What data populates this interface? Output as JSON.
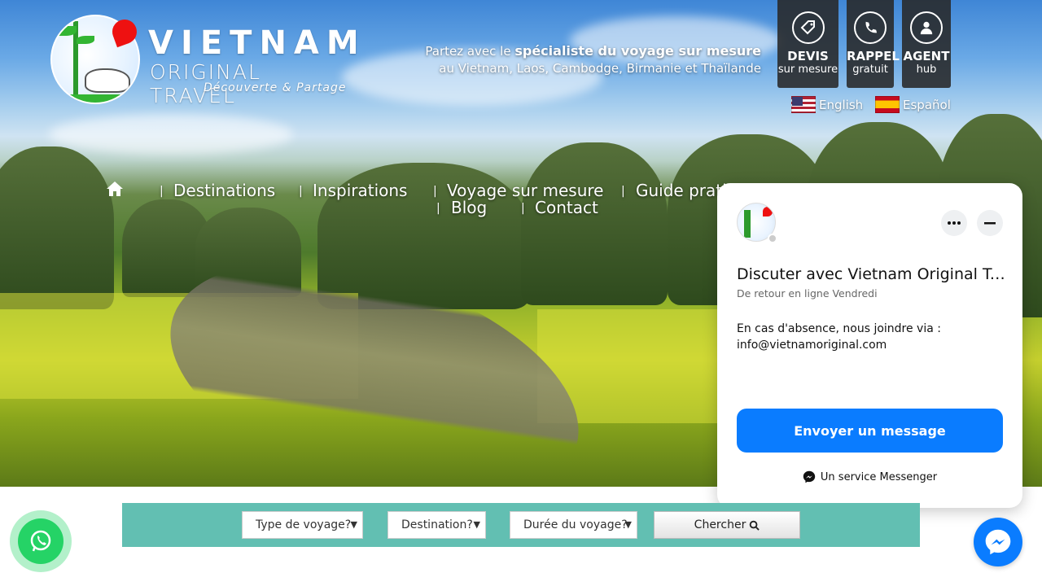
{
  "logo": {
    "word1": "VIETNAM",
    "word2": "ORIGINAL TRAVEL",
    "word3": "Découverte & Partage"
  },
  "tagline": {
    "line1_prefix": "Partez avec le ",
    "line1_bold": "spécialiste du voyage sur mesure",
    "line2": "au Vietnam, Laos, Cambodge, Birmanie et Thaïlande"
  },
  "top_buttons": [
    {
      "title": "DEVIS",
      "sub": "sur mesure",
      "icon": "tag-icon"
    },
    {
      "title": "RAPPEL",
      "sub": "gratuit",
      "icon": "phone-icon"
    },
    {
      "title": "AGENT",
      "sub": "hub",
      "icon": "user-icon"
    }
  ],
  "languages": [
    {
      "label": "English",
      "flag": "us-flag"
    },
    {
      "label": "Español",
      "flag": "es-flag"
    }
  ],
  "nav": {
    "home_icon": "home-icon",
    "items": [
      "Destinations",
      "Inspirations",
      "Voyage sur mesure",
      "Guide pratique",
      "Blog",
      "Contact"
    ]
  },
  "chat": {
    "title": "Discuter avec Vietnam Original Travel",
    "status": "De retour en ligne Vendredi",
    "message": "En cas d'absence, nous joindre via : info@vietnamoriginal.com",
    "send_label": "Envoyer un message",
    "footer": "Un service Messenger"
  },
  "search": {
    "type_label": "Type de voyage?",
    "destination_label": "Destination?",
    "duration_label": "Durée du voyage?",
    "button_label": "Chercher"
  },
  "colors": {
    "search_bg": "#62bfb2",
    "messenger_blue": "#0a7cff",
    "whatsapp_green": "#25d366"
  }
}
